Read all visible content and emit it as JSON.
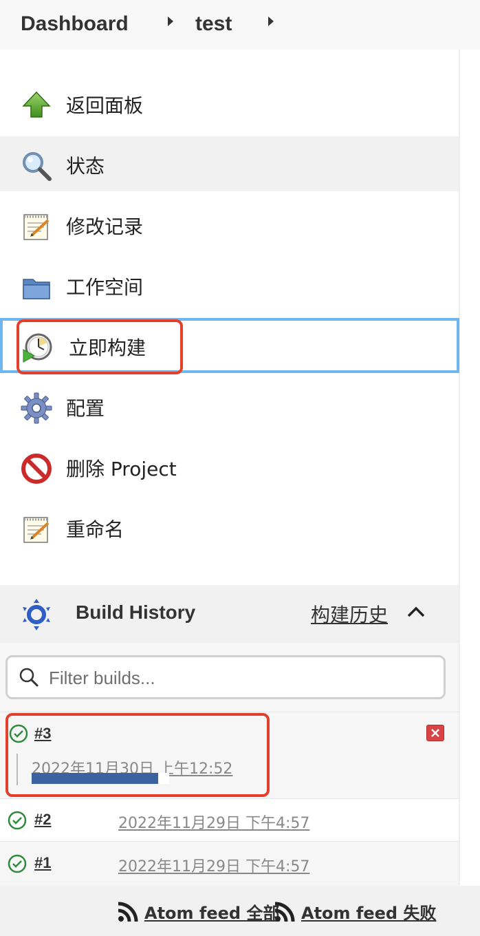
{
  "breadcrumb": {
    "items": [
      "Dashboard",
      "test"
    ]
  },
  "tasks": [
    {
      "label": "返回面板",
      "icon": "up-arrow-icon"
    },
    {
      "label": "状态",
      "icon": "magnifier-icon",
      "active": true
    },
    {
      "label": "修改记录",
      "icon": "notepad-icon"
    },
    {
      "label": "工作空间",
      "icon": "folder-icon"
    },
    {
      "label": "立即构建",
      "icon": "build-clock-icon",
      "focused": true
    },
    {
      "label": "配置",
      "icon": "gear-icon"
    },
    {
      "label": "删除 Project",
      "icon": "no-entry-icon"
    },
    {
      "label": "重命名",
      "icon": "notepad-icon"
    }
  ],
  "build_history": {
    "title": "Build History",
    "trend_link": "构建历史",
    "filter_placeholder": "Filter builds...",
    "builds": [
      {
        "number": "#3",
        "date": "2022年11月30日 上午12:52",
        "status": "success",
        "in_progress": true,
        "progress": 0.92
      },
      {
        "number": "#2",
        "date": "2022年11月29日 下午4:57",
        "status": "success"
      },
      {
        "number": "#1",
        "date": "2022年11月29日 下午4:57",
        "status": "success"
      }
    ]
  },
  "footer": {
    "feed_all": "Atom feed 全部",
    "feed_failed": "Atom feed 失败"
  },
  "colors": {
    "highlight": "#e3402b",
    "focus_border": "#6db6ef",
    "progress": "#3d62a0",
    "success": "#2e8b3d"
  }
}
